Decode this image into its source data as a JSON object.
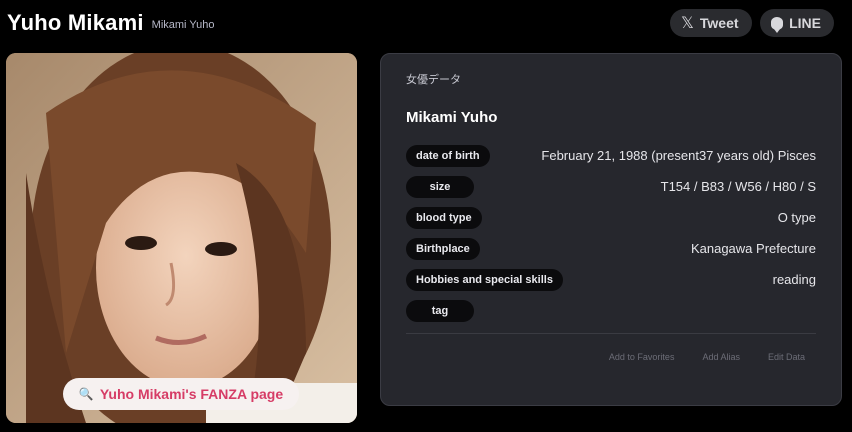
{
  "header": {
    "title": "Yuho Mikami",
    "subtitle": "Mikami Yuho"
  },
  "share": {
    "tweet_label": "Tweet",
    "line_label": "LINE",
    "tweet_icon": "x-logo-icon",
    "line_icon": "line-logo-icon"
  },
  "photo": {
    "fanza_link": "Yuho Mikami's FANZA page",
    "fanza_icon": "🔍"
  },
  "card": {
    "label": "女優データ",
    "name": "Mikami Yuho",
    "rows": [
      {
        "key": "date of birth",
        "value": "February 21, 1988 (present37 years old) Pisces"
      },
      {
        "key": "size",
        "value": "T154 / B83 / W56 / H80 / S"
      },
      {
        "key": "blood type",
        "value": "O type"
      },
      {
        "key": "Birthplace",
        "value": "Kanagawa Prefecture"
      },
      {
        "key": "Hobbies and special skills",
        "value": "reading"
      },
      {
        "key": "tag",
        "value": ""
      }
    ],
    "actions": {
      "favorites": "Add to Favorites",
      "alias": "Add Alias",
      "edit": "Edit Data"
    }
  },
  "colors": {
    "background": "#000000",
    "card": "#26272d",
    "accent_link": "#d63c66",
    "pill": "#0b0b0d"
  }
}
